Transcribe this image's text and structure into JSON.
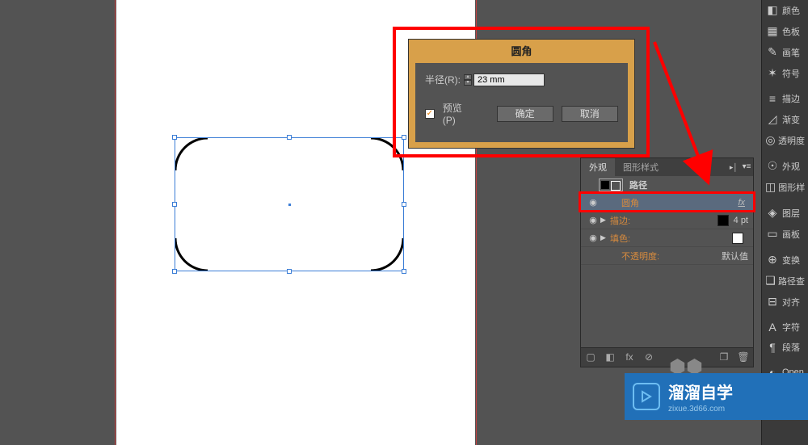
{
  "dialog": {
    "title": "圆角",
    "radius_label": "半径(R):",
    "radius_value": "23 mm",
    "preview_label": "预览(P)",
    "preview_checked": true,
    "ok_label": "确定",
    "cancel_label": "取消"
  },
  "panel": {
    "tabs": [
      "外观",
      "图形样式"
    ],
    "active_tab": 0,
    "rows": [
      {
        "type": "path",
        "label": "路径"
      },
      {
        "type": "effect",
        "label": "圆角",
        "selected": true,
        "fx": "fx"
      },
      {
        "type": "stroke",
        "label": "描边:",
        "swatch": "black",
        "value": "4 pt"
      },
      {
        "type": "fill",
        "label": "填色:",
        "swatch": "white"
      },
      {
        "type": "opacity",
        "label": "不透明度:",
        "value": "默认值"
      }
    ]
  },
  "dock": [
    {
      "icon": "◧",
      "label": "颜色"
    },
    {
      "icon": "▦",
      "label": "色板"
    },
    {
      "icon": "✎",
      "label": "画笔"
    },
    {
      "icon": "✶",
      "label": "符号"
    },
    {
      "sep": true
    },
    {
      "icon": "≡",
      "label": "描边"
    },
    {
      "icon": "◿",
      "label": "渐变"
    },
    {
      "icon": "◎",
      "label": "透明度"
    },
    {
      "sep": true
    },
    {
      "icon": "☉",
      "label": "外观"
    },
    {
      "icon": "◫",
      "label": "图形样"
    },
    {
      "sep": true
    },
    {
      "icon": "◈",
      "label": "图层"
    },
    {
      "icon": "▭",
      "label": "画板"
    },
    {
      "sep": true
    },
    {
      "icon": "⊕",
      "label": "变换"
    },
    {
      "icon": "❑",
      "label": "路径查"
    },
    {
      "icon": "⊟",
      "label": "对齐"
    },
    {
      "sep": true
    },
    {
      "icon": "A",
      "label": "字符"
    },
    {
      "icon": "¶",
      "label": "段落"
    },
    {
      "sep": true
    },
    {
      "icon": "◐",
      "label": "Open"
    }
  ],
  "watermark": {
    "title_cn": "溜溜自学",
    "subtitle": "zixue.3d66.com"
  }
}
